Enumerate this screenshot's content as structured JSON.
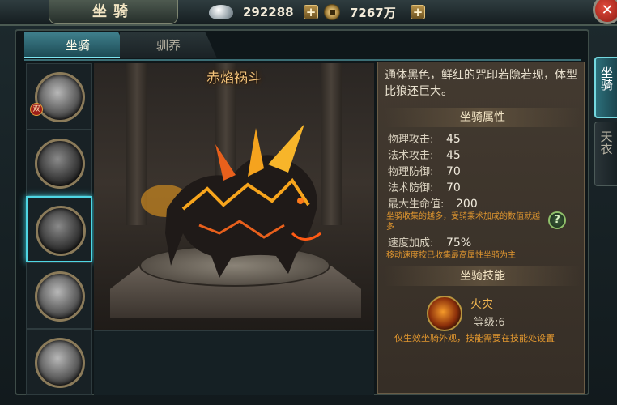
{
  "window": {
    "title": "坐骑"
  },
  "currency": {
    "silver": "292288",
    "gold": "7267万"
  },
  "tabs": [
    {
      "label": "坐骑",
      "active": true
    },
    {
      "label": "驯养",
      "active": false
    }
  ],
  "side_tabs": [
    {
      "label": "坐骑",
      "active": true
    },
    {
      "label": "天衣",
      "active": false
    }
  ],
  "mount_list": {
    "selected_index": 2,
    "badge": "双"
  },
  "mount": {
    "name": "赤焰祸斗",
    "description": "通体黑色，鲜红的咒印若隐若现，体型比狼还巨大。"
  },
  "attributes": {
    "heading": "坐骑属性",
    "items": [
      {
        "label": "物理攻击:",
        "value": "45"
      },
      {
        "label": "法术攻击:",
        "value": "45"
      },
      {
        "label": "物理防御:",
        "value": "70"
      },
      {
        "label": "法术防御:",
        "value": "70"
      },
      {
        "label": "最大生命值:",
        "value": "200"
      }
    ],
    "note1": "坐骑收集的越多，受骑乘术加成的数值就越多",
    "speed_label": "速度加成:",
    "speed_value": "75%",
    "note2": "移动速度按已收集最高属性坐骑为主",
    "help": "?"
  },
  "skill": {
    "heading": "坐骑技能",
    "name": "火灾",
    "level": "等级:6",
    "note": "仅生效坐骑外观，技能需要在技能处设置"
  },
  "colors": {
    "accent": "#4fd6e4",
    "gold_text": "#f5c47a",
    "note_text": "#e0962f"
  }
}
